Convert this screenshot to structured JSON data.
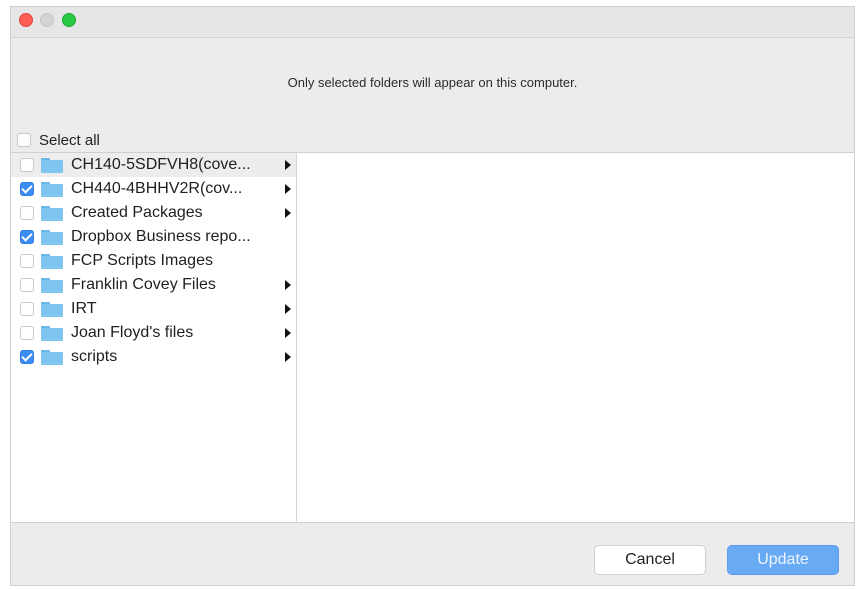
{
  "window": {
    "traffic_lights": [
      "close",
      "minimize",
      "zoom"
    ]
  },
  "header": {
    "message": "Only selected folders will appear on this computer."
  },
  "select_all": {
    "label": "Select all",
    "checked": false
  },
  "folders": [
    {
      "name": "CH140-5SDFVH8(cove...",
      "checked": false,
      "has_children": true
    },
    {
      "name": "CH440-4BHHV2R(cov...",
      "checked": true,
      "has_children": true
    },
    {
      "name": "Created Packages",
      "checked": false,
      "has_children": true
    },
    {
      "name": "Dropbox Business repo...",
      "checked": true,
      "has_children": false
    },
    {
      "name": "FCP Scripts Images",
      "checked": false,
      "has_children": false
    },
    {
      "name": "Franklin Covey Files",
      "checked": false,
      "has_children": true
    },
    {
      "name": "IRT",
      "checked": false,
      "has_children": true
    },
    {
      "name": "Joan Floyd's files",
      "checked": false,
      "has_children": true
    },
    {
      "name": "scripts",
      "checked": true,
      "has_children": true
    }
  ],
  "buttons": {
    "cancel": "Cancel",
    "update": "Update"
  },
  "colors": {
    "accent": "#3b8ef3",
    "folder": "#7ec6ef",
    "update_button": "#69aaf5"
  }
}
